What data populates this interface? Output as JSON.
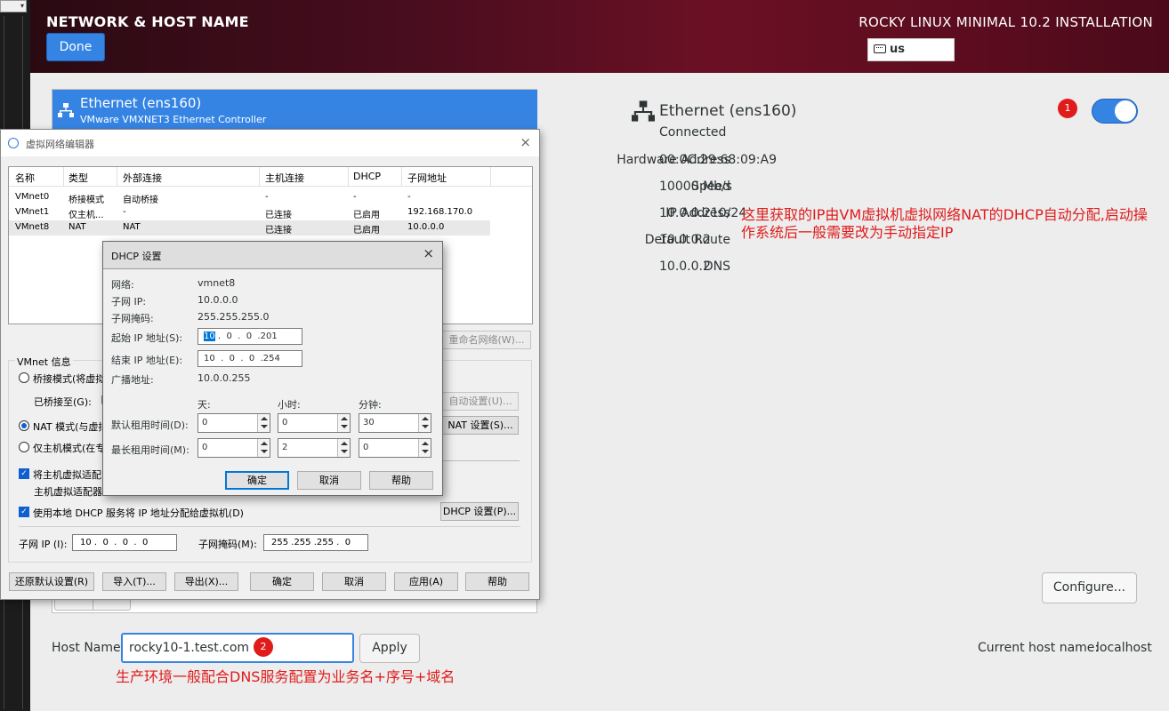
{
  "left_strip": {
    "combo_glyph": "▾"
  },
  "header": {
    "title": "NETWORK & HOST NAME",
    "done_label": "Done",
    "product": "ROCKY LINUX MINIMAL 10.2 INSTALLATION",
    "keyboard_layout": "us"
  },
  "eth_list": {
    "selected_name": "Ethernet (ens160)",
    "selected_desc": "VMware VMXNET3 Ethernet Controller"
  },
  "details": {
    "name": "Ethernet (ens160)",
    "status": "Connected",
    "hardware_address_label": "Hardware Address",
    "hardware_address": "00:0C:29:68:09:A9",
    "speed_label": "Speed",
    "speed": "10000 Mb/s",
    "ip_label": "IP Address",
    "ip": "10.0.0.210/24",
    "route_label": "Default Route",
    "route": "10.0.0.2",
    "dns_label": "DNS",
    "dns": "10.0.0.2",
    "toggle_on": true,
    "configure_label": "Configure...",
    "badge1": "1",
    "annotation1_line1": "这里获取的IP由VM虚拟机虚拟网络NAT的DHCP自动分配,启动操",
    "annotation1_line2": "作系统后一般需要改为手动指定IP"
  },
  "hostname": {
    "label": "Host Name:",
    "value": "rocky10-1.test.com",
    "apply_label": "Apply",
    "current_label": "Current host name:",
    "current_value": "localhost",
    "badge2": "2",
    "annotation2": "生产环境一般配合DNS服务配置为业务名+序号+域名"
  },
  "vne": {
    "title": "虚拟网络编辑器",
    "close": "×",
    "columns": [
      "名称",
      "类型",
      "外部连接",
      "主机连接",
      "DHCP",
      "子网地址"
    ],
    "rows": [
      [
        "VMnet0",
        "桥接模式",
        "自动桥接",
        "-",
        "-",
        "-"
      ],
      [
        "VMnet1",
        "仅主机...",
        "-",
        "已连接",
        "已启用",
        "192.168.170.0"
      ],
      [
        "VMnet8",
        "NAT",
        "NAT",
        "已连接",
        "已启用",
        "10.0.0.0"
      ]
    ],
    "rename_button": "重命名网络(W)...",
    "group_label": "VMnet 信息",
    "radio_bridge": "桥接模式(将虚拟",
    "bridged_to_label": "已桥接至(G):",
    "bridged_to_value": "[",
    "auto_settings": "自动设置(U)...",
    "radio_nat": "NAT 模式(与虚拟",
    "nat_settings": "NAT 设置(S)...",
    "radio_host": "仅主机模式(在专",
    "check_adapter": "将主机虚拟适配",
    "adapter_sub": "主机虚拟适配器",
    "check_dhcp": "使用本地 DHCP 服务将 IP 地址分配给虚拟机(D)",
    "dhcp_settings": "DHCP 设置(P)...",
    "subnet_ip_label": "子网 IP (I):",
    "subnet_ip": "10 .  0  .  0  .  0",
    "subnet_mask_label": "子网掩码(M):",
    "subnet_mask": "255 .255 .255 .  0",
    "btn_restore": "还原默认设置(R)",
    "btn_import": "导入(T)...",
    "btn_export": "导出(X)...",
    "btn_ok": "确定",
    "btn_cancel": "取消",
    "btn_apply": "应用(A)",
    "btn_help": "帮助"
  },
  "dhcp": {
    "title": "DHCP 设置",
    "close": "×",
    "network_label": "网络:",
    "network_value": "vmnet8",
    "subnet_ip_label": "子网 IP:",
    "subnet_ip_value": "10.0.0.0",
    "subnet_mask_label": "子网掩码:",
    "subnet_mask_value": "255.255.255.0",
    "start_label": "起始 IP 地址(S):",
    "start_first": "10",
    "start_rest": " .  0  .  0  .201",
    "end_label": "结束 IP 地址(E):",
    "end_value": "10  .  0  .  0  .254",
    "broadcast_label": "广播地址:",
    "broadcast_value": "10.0.0.255",
    "days_label": "天:",
    "hours_label": "小时:",
    "minutes_label": "分钟:",
    "default_lease_label": "默认租用时间(D):",
    "default_days": "0",
    "default_hours": "0",
    "default_minutes": "30",
    "max_lease_label": "最长租用时间(M):",
    "max_days": "0",
    "max_hours": "2",
    "max_minutes": "0",
    "btn_ok": "确定",
    "btn_cancel": "取消",
    "btn_help": "帮助"
  }
}
